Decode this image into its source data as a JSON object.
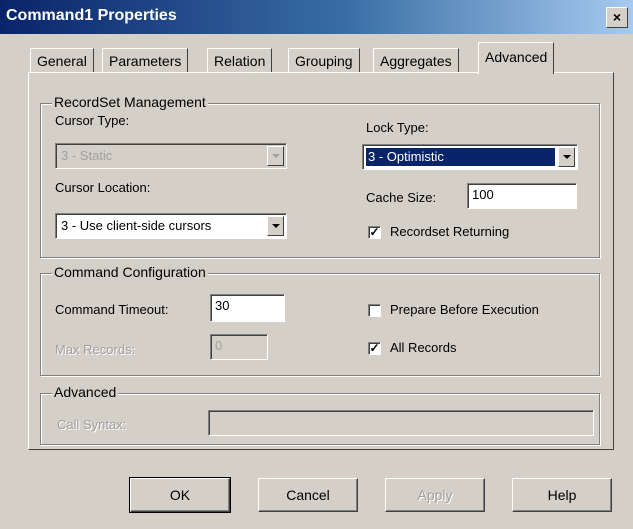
{
  "window": {
    "title": "Command1 Properties",
    "close_glyph": "×"
  },
  "tabs": [
    {
      "label": "General",
      "active": false
    },
    {
      "label": "Parameters",
      "active": false
    },
    {
      "label": "Relation",
      "active": false
    },
    {
      "label": "Grouping",
      "active": false
    },
    {
      "label": "Aggregates",
      "active": false
    },
    {
      "label": "Advanced",
      "active": true
    }
  ],
  "recordset": {
    "legend": "RecordSet Management",
    "cursor_type_label": "Cursor Type:",
    "cursor_type_value": "3 - Static",
    "cursor_location_label": "Cursor Location:",
    "cursor_location_value": "3 - Use client-side cursors",
    "lock_type_label": "Lock Type:",
    "lock_type_value": "3 - Optimistic",
    "cache_size_label": "Cache Size:",
    "cache_size_value": "100",
    "recordset_returning_label": "Recordset Returning",
    "recordset_returning_checked": true
  },
  "command": {
    "legend": "Command Configuration",
    "timeout_label": "Command Timeout:",
    "timeout_value": "30",
    "max_records_label": "Max Records:",
    "max_records_value": "0",
    "prepare_label": "Prepare Before Execution",
    "prepare_checked": false,
    "all_records_label": "All Records",
    "all_records_checked": true
  },
  "advanced": {
    "legend": "Advanced",
    "call_syntax_label": "Call Syntax:",
    "call_syntax_value": ""
  },
  "buttons": {
    "ok": "OK",
    "cancel": "Cancel",
    "apply": "Apply",
    "help": "Help"
  },
  "check_glyph": "✓",
  "colors": {
    "title_gradient_start": "#0a246a",
    "face": "#d4d0c8",
    "selection": "#0a246a"
  }
}
